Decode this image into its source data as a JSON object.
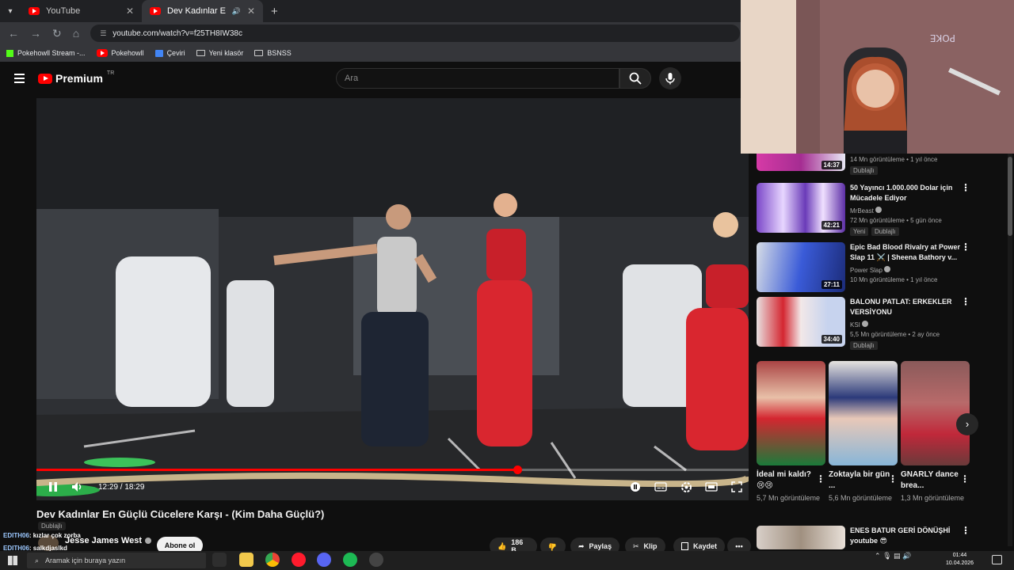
{
  "browser": {
    "tabs": [
      {
        "title": "YouTube"
      },
      {
        "title": "Dev Kadınlar En Güçlü Cüce"
      }
    ],
    "new_tab": "+",
    "url": "youtube.com/watch?v=f25TH8IW38c",
    "bookmarks": [
      "Pokehowll Stream -...",
      "Pokehowll",
      "Çeviri",
      "Yeni klasör",
      "BSNSS"
    ]
  },
  "youtube": {
    "logo_text": "Premium",
    "region": "TR",
    "search_placeholder": "Ara"
  },
  "player": {
    "time": "12:29 / 18:29",
    "progress": 0.675
  },
  "video": {
    "title": "Dev Kadınlar En Güçlü Cücelere Karşı - (Kim Daha Güçlü?)",
    "dub_badge": "Dublajlı",
    "channel": "Jesse James West",
    "subscribe": "Abone ol",
    "likes": "186 B",
    "share": "Paylaş",
    "clip": "Klip",
    "save": "Kaydet",
    "more": "•••"
  },
  "chat": [
    {
      "user": "EDITH06",
      "message": ": kızlar çok zorba"
    },
    {
      "user": "EDITH06",
      "message": ": salkdjaslkd"
    }
  ],
  "recommendations": [
    {
      "title": "",
      "channel": "",
      "meta": "14 Mn görüntüleme • 1 yıl önce",
      "duration": "14:37",
      "badges": [
        "Dublajlı"
      ]
    },
    {
      "title": "50 Yayıncı 1.000.000 Dolar için Mücadele Ediyor",
      "channel": "MrBeast",
      "meta": "72 Mn görüntüleme • 5 gün önce",
      "duration": "42:21",
      "badges": [
        "Yeni",
        "Dublajlı"
      ]
    },
    {
      "title": "Epic Bad Blood Rivalry at Power Slap 11 ⚔️ | Sheena Bathory v...",
      "channel": "Power Slap",
      "meta": "10 Mn görüntüleme • 1 yıl önce",
      "duration": "27:11",
      "badges": []
    },
    {
      "title": "BALONU PATLAT: ERKEKLER VERSİYONU",
      "channel": "KSI",
      "meta": "5,5 Mn görüntüleme • 2 ay önce",
      "duration": "34:40",
      "badges": [
        "Dublajlı"
      ]
    }
  ],
  "shorts": [
    {
      "title": "İdeal mi kaldı? 😢😢",
      "views": "5,7 Mn görüntüleme"
    },
    {
      "title": "Zoktayla bir gün ...",
      "views": "5,6 Mn görüntüleme"
    },
    {
      "title": "GNARLY dance brea...",
      "views": "1,3 Mn görüntüleme"
    }
  ],
  "last_rec": {
    "title": "ENES BATUR GERİ DÖNÜŞHİ youtube 😎"
  },
  "taskbar": {
    "search_placeholder": "Aramak için buraya yazın",
    "time": "01:44",
    "date": "10.04.2026"
  },
  "colors": {
    "accent": "#ff0000",
    "background": "#0f0f0f"
  }
}
